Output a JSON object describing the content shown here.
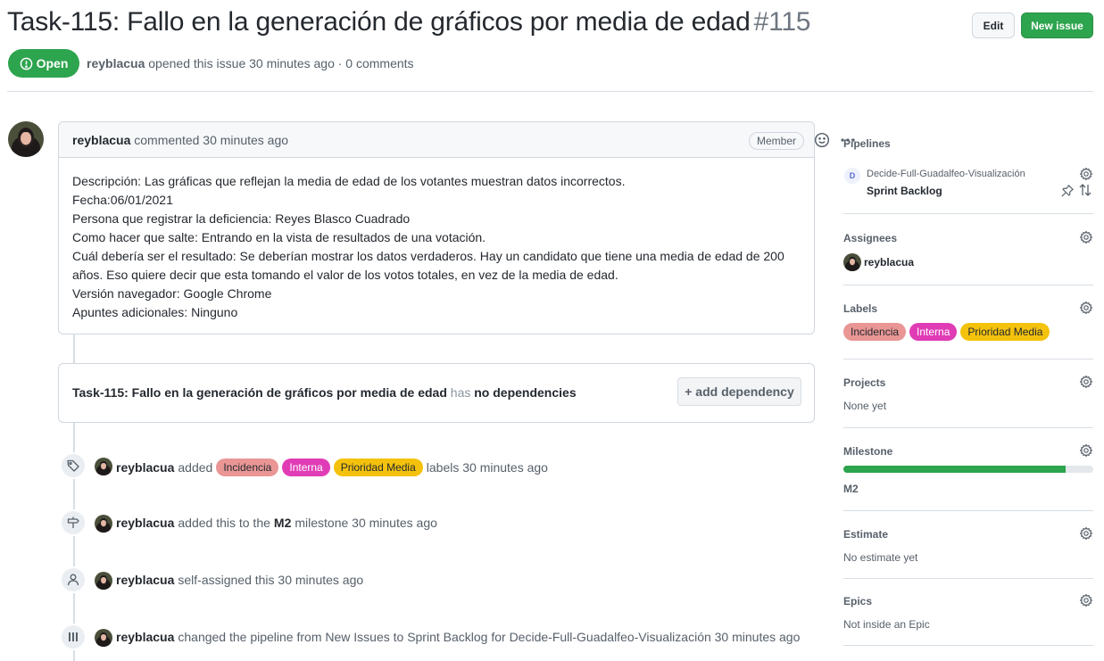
{
  "header": {
    "title": "Task-115: Fallo en la generación de gráficos por media de edad",
    "number": "#115",
    "edit_label": "Edit",
    "new_issue_label": "New issue",
    "state": "Open",
    "author": "reyblacua",
    "opened_text": "opened this issue 30 minutes ago · 0 comments"
  },
  "comment": {
    "author": "reyblacua",
    "time_text": "commented 30 minutes ago",
    "role": "Member",
    "body": [
      "Descripción: Las gráficas que reflejan la media de edad de los votantes muestran datos incorrectos.",
      "Fecha:06/01/2021",
      "Persona que registrar la deficiencia: Reyes Blasco Cuadrado",
      "Como hacer que salte: Entrando en la vista de resultados de una votación.",
      "Cuál debería ser el resultado: Se deberían mostrar los datos verdaderos. Hay un candidato que tiene una media de edad de 200 años. Eso quiere decir que esta tomando el valor de los votos totales, en vez de la media de edad.",
      "Versión navegador: Google Chrome",
      "Apuntes adicionales: Ninguno"
    ]
  },
  "dependencies": {
    "issue": "Task-115: Fallo en la generación de gráficos por media de edad",
    "has": "has",
    "status": "no dependencies",
    "add_label": "+ add dependency"
  },
  "events": [
    {
      "icon": "tag-icon",
      "actor": "reyblacua",
      "before": "added",
      "after": "labels 30 minutes ago"
    },
    {
      "icon": "milestone-icon",
      "actor": "reyblacua",
      "before": "added this to the",
      "strong": "M2",
      "after": "milestone 30 minutes ago"
    },
    {
      "icon": "person-icon",
      "actor": "reyblacua",
      "before": "self-assigned this 30 minutes ago"
    },
    {
      "icon": "pipeline-icon",
      "actor": "reyblacua",
      "before": "changed the pipeline from New Issues to Sprint Backlog for Decide-Full-Guadalfeo-Visualización 30 minutes ago"
    }
  ],
  "labels": [
    {
      "name": "Incidencia",
      "color": "#e99695"
    },
    {
      "name": "Interna",
      "color": "#e03cb5"
    },
    {
      "name": "Prioridad Media",
      "color": "#f4c20d"
    }
  ],
  "sidebar": {
    "pipelines_title": "Pipelines",
    "pipeline_repo_initial": "D",
    "pipeline_repo": "Decide-Full-Guadalfeo-Visualización",
    "pipeline_name": "Sprint Backlog",
    "assignees_title": "Assignees",
    "assignee": "reyblacua",
    "labels_title": "Labels",
    "projects_title": "Projects",
    "projects_value": "None yet",
    "milestone_title": "Milestone",
    "milestone_name": "M2",
    "milestone_progress": 0.89,
    "estimate_title": "Estimate",
    "estimate_value": "No estimate yet",
    "epics_title": "Epics",
    "epics_value": "Not inside an Epic"
  },
  "colors": {
    "open_green": "#2da44e",
    "border": "#d0d7de",
    "muted_text": "#57606a"
  }
}
